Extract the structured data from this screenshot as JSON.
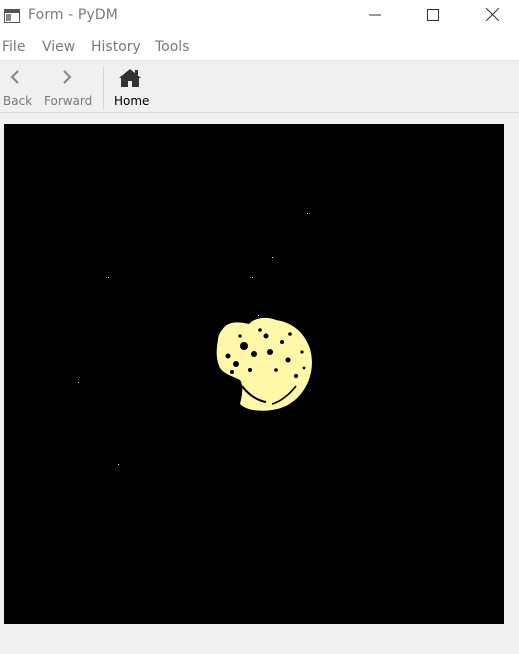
{
  "window": {
    "title": "Form - PyDM"
  },
  "menu": {
    "items": [
      "File",
      "View",
      "History",
      "Tools"
    ]
  },
  "toolbar": {
    "back_label": "Back",
    "forward_label": "Forward",
    "home_label": "Home"
  },
  "icons": {
    "app": "window-icon",
    "minimize": "minimize-icon",
    "maximize": "maximize-icon",
    "close": "close-icon",
    "back": "chevron-left-icon",
    "forward": "chevron-right-icon",
    "home": "home-icon"
  },
  "colors": {
    "image_background": "#000000",
    "blob": "#fff8a8",
    "disabled_text": "#7a7a7a"
  }
}
